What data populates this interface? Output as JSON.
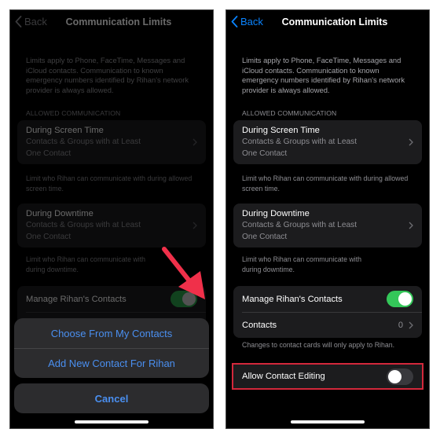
{
  "colors": {
    "accent_blue": "#0a84ff",
    "sheet_blue": "#4a8ff0",
    "toggle_on": "#34c759",
    "highlight_red": "#d3283b",
    "arrow_red": "#f0304a"
  },
  "left_screen": {
    "nav": {
      "back_label": "Back",
      "title": "Communication Limits"
    },
    "description": "Limits apply to Phone, FaceTime, Messages and iCloud contacts. Communication to known emergency numbers identified by Rihan's network provider is always allowed.",
    "section_header": "ALLOWED COMMUNICATION",
    "screen_time": {
      "title": "During Screen Time",
      "subtitle_line1": "Contacts & Groups with at Least",
      "subtitle_line2": "One Contact",
      "footer": "Limit who Rihan can communicate with during allowed screen time."
    },
    "downtime": {
      "title": "During Downtime",
      "subtitle_line1": "Contacts & Groups with at Least",
      "subtitle_line2": "One Contact",
      "footer_line1": "Limit who Rihan can communicate with",
      "footer_line2": "during downtime."
    },
    "manage_contacts": {
      "label": "Manage Rihan's Contacts",
      "toggle_on": true
    },
    "action_sheet": {
      "options": [
        "Choose From My Contacts",
        "Add New Contact For Rihan"
      ],
      "cancel": "Cancel"
    }
  },
  "right_screen": {
    "nav": {
      "back_label": "Back",
      "title": "Communication Limits"
    },
    "description": "Limits apply to Phone, FaceTime, Messages and iCloud contacts. Communication to known emergency numbers identified by Rihan's network provider is always allowed.",
    "section_header": "ALLOWED COMMUNICATION",
    "screen_time": {
      "title": "During Screen Time",
      "subtitle_line1": "Contacts & Groups with at Least",
      "subtitle_line2": "One Contact",
      "footer": "Limit who Rihan can communicate with during allowed screen time."
    },
    "downtime": {
      "title": "During Downtime",
      "subtitle_line1": "Contacts & Groups with at Least",
      "subtitle_line2": "One Contact",
      "footer_line1": "Limit who Rihan can communicate with",
      "footer_line2": "during downtime."
    },
    "manage_contacts": {
      "label": "Manage Rihan's Contacts",
      "toggle_on": true
    },
    "contacts": {
      "label": "Contacts",
      "count": "0"
    },
    "contacts_footer": "Changes to contact cards will only apply to Rihan.",
    "allow_editing": {
      "label": "Allow Contact Editing",
      "toggle_on": false
    }
  }
}
